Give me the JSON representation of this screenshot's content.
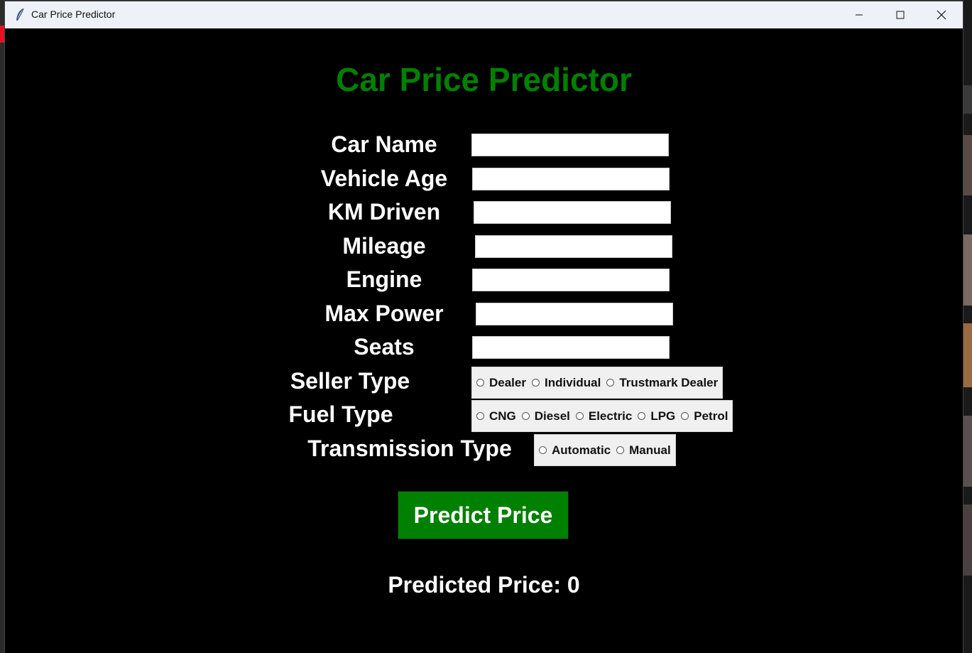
{
  "window": {
    "title": "Car Price Predictor"
  },
  "form": {
    "heading": "Car Price Predictor",
    "fields": [
      {
        "label": "Car Name",
        "value": ""
      },
      {
        "label": "Vehicle Age",
        "value": ""
      },
      {
        "label": "KM Driven",
        "value": ""
      },
      {
        "label": "Mileage",
        "value": ""
      },
      {
        "label": "Engine",
        "value": ""
      },
      {
        "label": "Max Power",
        "value": ""
      },
      {
        "label": "Seats",
        "value": ""
      }
    ],
    "seller_type": {
      "label": "Seller Type",
      "options": [
        "Dealer",
        "Individual",
        "Trustmark Dealer"
      ]
    },
    "fuel_type": {
      "label": "Fuel Type",
      "options": [
        "CNG",
        "Diesel",
        "Electric",
        "LPG",
        "Petrol"
      ]
    },
    "transmission_type": {
      "label": "Transmission Type",
      "options": [
        "Automatic",
        "Manual"
      ]
    },
    "predict_label": "Predict Price",
    "result_prefix": "Predicted Price:",
    "result_value": "0"
  },
  "colors": {
    "accent_green": "#008000",
    "background": "#000000",
    "titlebar": "#eef1f8"
  },
  "icons": {
    "app": "feather-icon",
    "minimize": "minimize-icon",
    "maximize": "maximize-icon",
    "close": "close-icon"
  }
}
